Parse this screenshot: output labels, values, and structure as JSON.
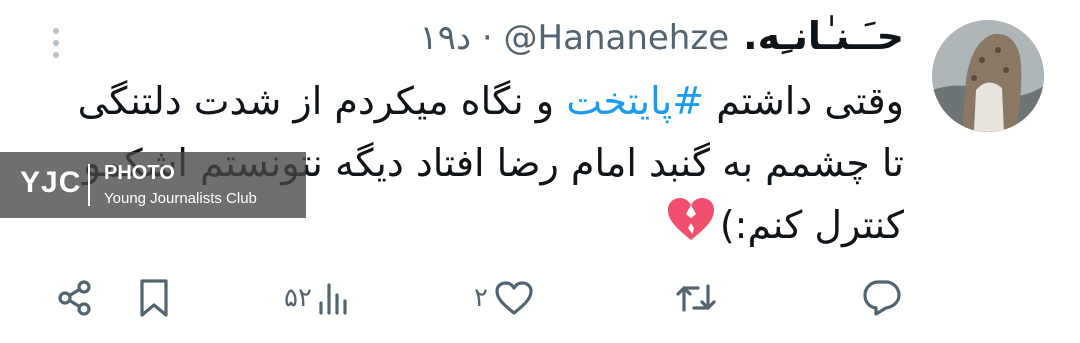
{
  "tweet": {
    "display_name": ".حـَـنـٰانـِه",
    "handle": "@Hananehze",
    "dot": "·",
    "time": "۱۹د",
    "text_lines": {
      "l1_pre": "وقتی داشتم ",
      "l1_hashtag": "#پایتخت",
      "l1_post": " و نگاه میکردم از شدت دلتنگی",
      "l2": "تا چشمم به گنبد امام رضا افتاد دیگه نتونستم اشکمو",
      "l3": "کنترل کنم:)"
    },
    "hashtag_color": "#1d9bf0"
  },
  "watermark": {
    "brand": "YJC",
    "title": "PHOTO",
    "subtitle": "Young Journalists Club"
  },
  "actions": {
    "reply_icon": "reply-icon",
    "retweet_icon": "retweet-icon",
    "like_icon": "like-icon",
    "like_count": "۲",
    "views_icon": "views-icon",
    "views_count": "۵۲",
    "bookmark_icon": "bookmark-icon",
    "share_icon": "share-icon"
  },
  "colors": {
    "text": "#0f1419",
    "secondary": "#536471",
    "accent": "#1d9bf0"
  }
}
